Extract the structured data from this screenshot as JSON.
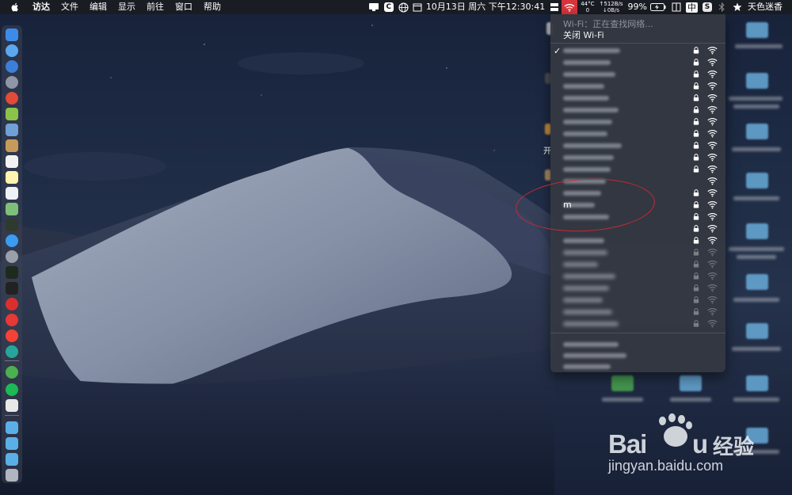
{
  "menubar": {
    "app": "访达",
    "menus": [
      "文件",
      "编辑",
      "显示",
      "前往",
      "窗口",
      "帮助"
    ],
    "status": {
      "date_time": "10月13日 周六 下午12:30:41",
      "temp": "44°C",
      "temp_sub": "0",
      "net_up": "↑512B/s",
      "net_down": "↓0B/s",
      "battery": "99%",
      "input_method": "中",
      "user": "天色迷香",
      "c_icon": "C",
      "s_icon": "S"
    }
  },
  "wifi_menu": {
    "status": "Wi-Fi：正在查找网络...",
    "toggle": "关闭 Wi-Fi",
    "visible_network": "m"
  },
  "desktop": {
    "side_char_1": "开"
  },
  "watermark": {
    "logo_text": "Bai",
    "logo_text2": "u",
    "logo_cn": "经验",
    "url": "jingyan.baidu.com"
  },
  "colors": {
    "menubar": "#1a1c22",
    "wifi_active": "#d8333b",
    "menu_bg": "#343842",
    "annotation": "#c72a33"
  }
}
